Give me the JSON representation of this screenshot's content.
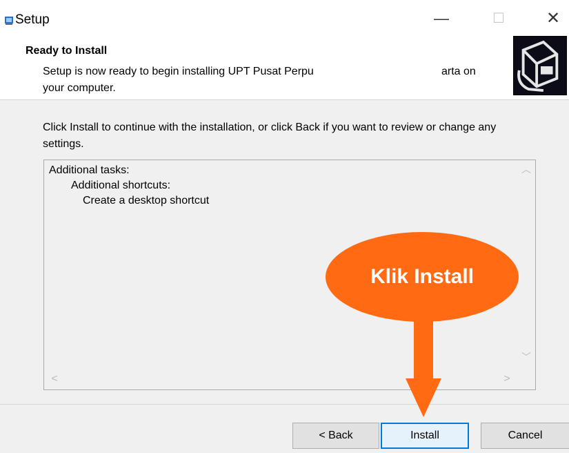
{
  "window": {
    "title": "Setup",
    "minimize_glyph": "—",
    "maximize_glyph": "☐",
    "close_glyph": "✕"
  },
  "header": {
    "title": "Ready to Install",
    "subtitle": "Setup is now ready to begin installing UPT Pusat Perpu",
    "subtitle_tail": "arta on",
    "subtitle_line2": "your computer."
  },
  "main": {
    "instruction": "Click Install to continue with the installation, or click Back if you want to review or change any settings.",
    "memo_lines": [
      "Additional tasks:",
      "Additional shortcuts:",
      "Create a desktop shortcut"
    ]
  },
  "footer": {
    "back_label": "< Back",
    "install_label": "Install",
    "cancel_label": "Cancel"
  },
  "annotation": {
    "callout_text": "Klik Install",
    "color": "#ff6a13"
  },
  "icons": {
    "app": "setup-app-icon",
    "header_image": "computer-install-icon"
  }
}
